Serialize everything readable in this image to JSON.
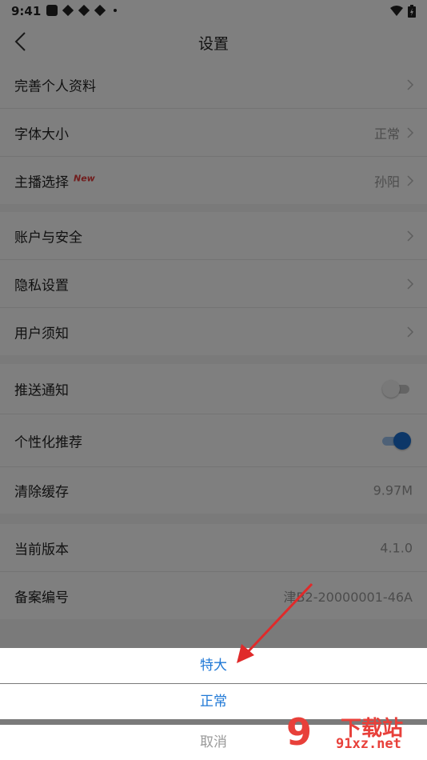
{
  "status": {
    "time": "9:41"
  },
  "header": {
    "title": "设置"
  },
  "groups": [
    {
      "items": [
        {
          "label": "完善个人资料",
          "value": ""
        },
        {
          "label": "字体大小",
          "value": "正常"
        },
        {
          "label": "主播选择",
          "badge": "New",
          "value": "孙阳"
        }
      ]
    },
    {
      "items": [
        {
          "label": "账户与安全"
        },
        {
          "label": "隐私设置"
        },
        {
          "label": "用户须知"
        }
      ]
    },
    {
      "items": [
        {
          "label": "推送通知",
          "toggle": false
        },
        {
          "label": "个性化推荐",
          "toggle": true
        },
        {
          "label": "清除缓存",
          "value": "9.97M"
        }
      ]
    },
    {
      "items": [
        {
          "label": "当前版本",
          "value": "4.1.0"
        },
        {
          "label": "备案编号",
          "value": "津B2-20000001-46A"
        }
      ]
    }
  ],
  "sheet": {
    "option1": "特大",
    "option2": "正常",
    "cancel": "取消"
  },
  "watermark": {
    "glyph": "9",
    "cn": "下载站",
    "url": "91xz.net"
  },
  "colors": {
    "accent": "#1f78d6",
    "toggle_on": "#1a6fd0",
    "badge": "#e23b3b"
  }
}
